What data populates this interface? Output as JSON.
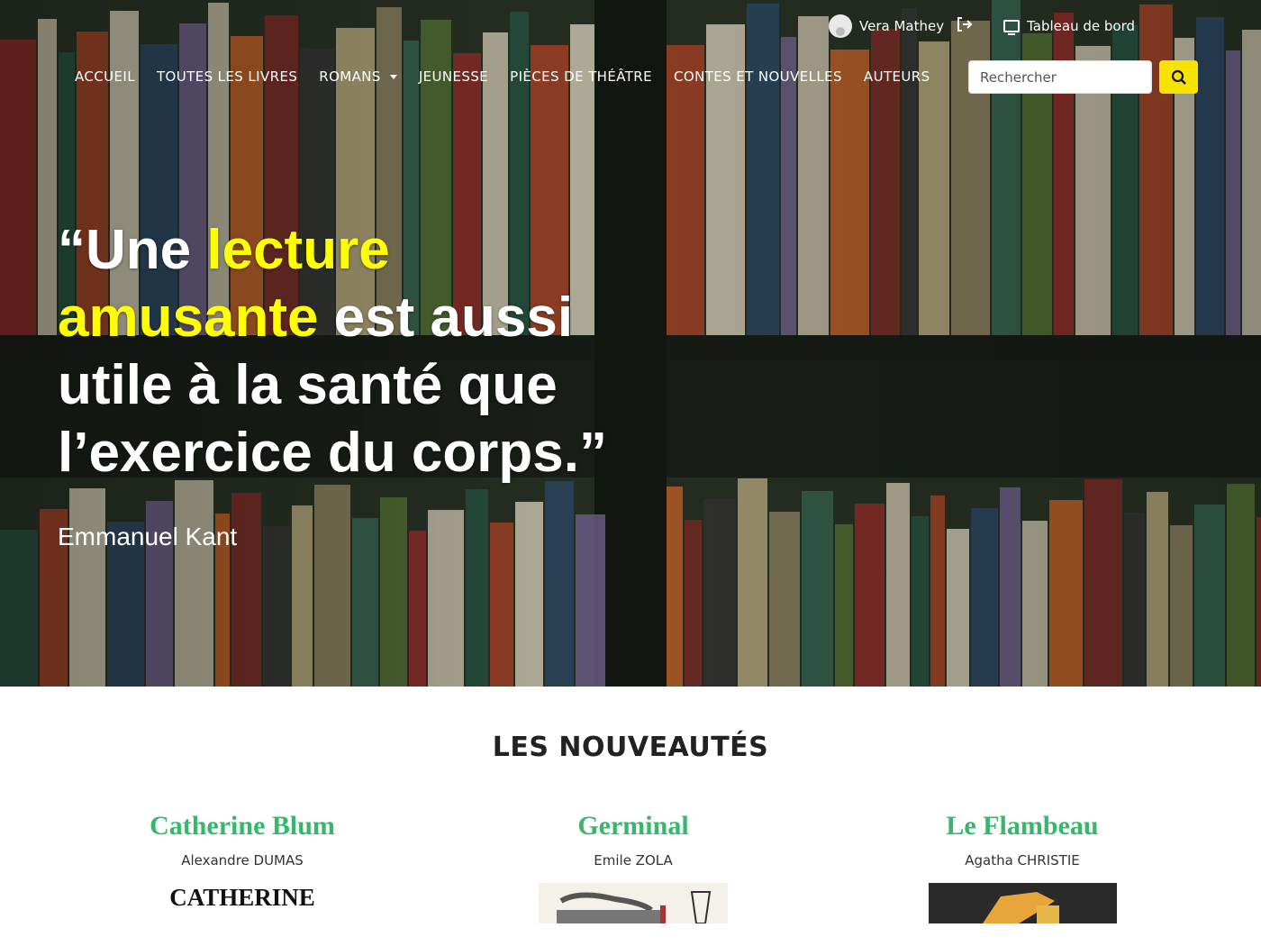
{
  "user": {
    "name": "Vera  Mathey"
  },
  "dashboard": {
    "label": "Tableau de bord"
  },
  "nav": {
    "items": [
      {
        "label": "Accueil"
      },
      {
        "label": "Toutes les livres"
      },
      {
        "label": "Romans"
      },
      {
        "label": "Jeunesse"
      },
      {
        "label": "Pièces de théâtre"
      },
      {
        "label": "Contes et nouvelles"
      },
      {
        "label": "Auteurs"
      }
    ]
  },
  "search": {
    "placeholder": "Rechercher"
  },
  "hero": {
    "quote_parts": {
      "open": "“Une ",
      "hl1": "lecture amusante",
      "mid": " est aussi utile à la santé que l’exercice du corps.”"
    },
    "author": "Emmanuel Kant"
  },
  "section": {
    "title": "Les nouveautés"
  },
  "books": [
    {
      "title": "Catherine Blum",
      "author": "Alexandre  DUMAS",
      "cover_text": "CATHERINE"
    },
    {
      "title": "Germinal",
      "author": "Emile  ZOLA"
    },
    {
      "title": "Le Flambeau",
      "author": "Agatha  CHRISTIE"
    }
  ],
  "colors": {
    "accent": "#f6e300",
    "title_green": "#35b86a",
    "highlight": "#ffff00"
  }
}
